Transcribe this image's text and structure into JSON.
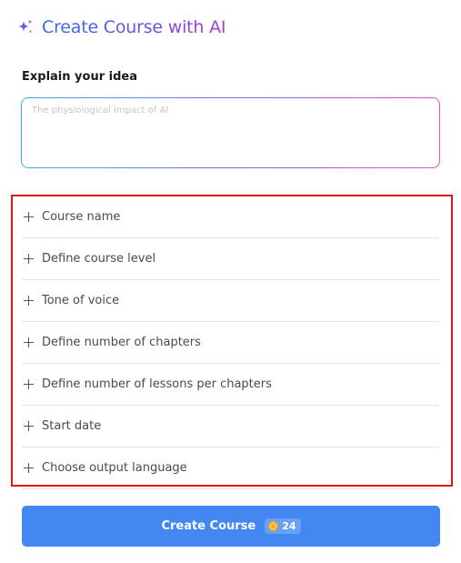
{
  "header": {
    "title": "Create Course with AI",
    "icon": "sparkle-icon"
  },
  "idea": {
    "label": "Explain your idea",
    "placeholder": "The physiological impact of AI",
    "value": ""
  },
  "options": [
    {
      "label": "Course name",
      "icon": "plus-icon"
    },
    {
      "label": "Define course level",
      "icon": "plus-icon"
    },
    {
      "label": "Tone of voice",
      "icon": "plus-icon"
    },
    {
      "label": "Define number of chapters",
      "icon": "plus-icon"
    },
    {
      "label": "Define number of lessons per chapters",
      "icon": "plus-icon"
    },
    {
      "label": "Start date",
      "icon": "plus-icon"
    },
    {
      "label": "Choose output language",
      "icon": "plus-icon"
    }
  ],
  "create_button": {
    "label": "Create Course",
    "credits": "24",
    "credit_icon": "coin-icon"
  },
  "colors": {
    "accent": "#4387f3",
    "title_gradient": [
      "#2f6fec",
      "#6a54e0",
      "#b03bd1"
    ],
    "highlight_frame": "#e0141e",
    "coin": "#f6c343"
  }
}
